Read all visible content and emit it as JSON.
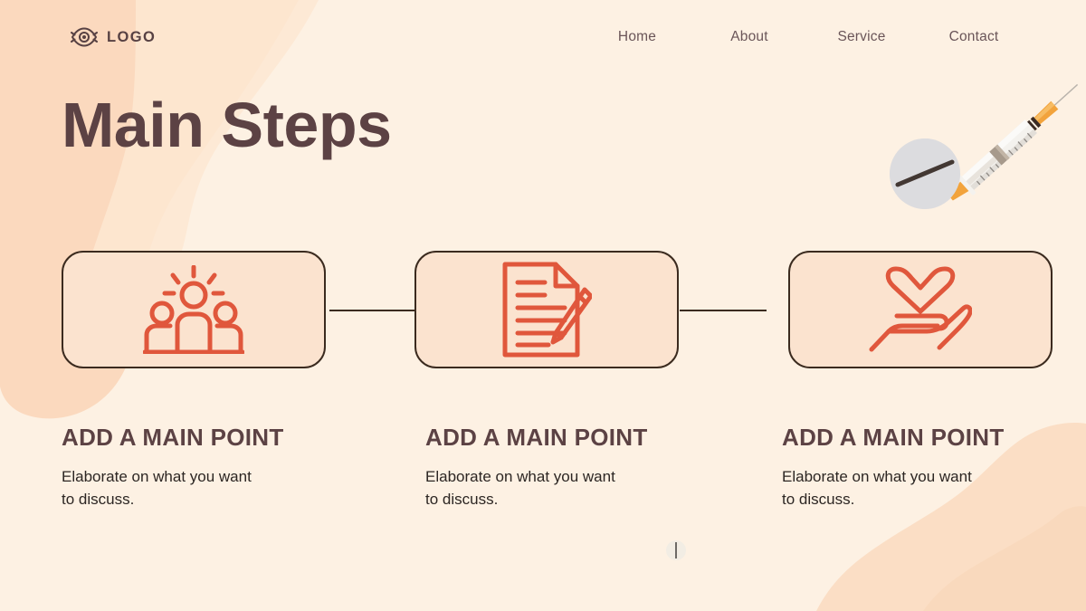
{
  "slide": {
    "title": "Main Steps",
    "background_color": "#FDF1E3",
    "accent_color": "#E0573C",
    "ink_color": "#5C4244",
    "card_fill_color": "#FBE3CF",
    "card_border_color": "#3B2B1F",
    "blob_color": "#FBD9BE"
  },
  "header": {
    "logo": {
      "icon": "eye-icon",
      "text": "LOGO"
    },
    "nav": [
      {
        "label": "Home"
      },
      {
        "label": "About"
      },
      {
        "label": "Service"
      },
      {
        "label": "Contact"
      }
    ]
  },
  "steps": [
    {
      "icon": "group-people-idea-icon",
      "title": "ADD A MAIN POINT",
      "body": "Elaborate on what you want to discuss."
    },
    {
      "icon": "document-pencil-icon",
      "title": "ADD A MAIN POINT",
      "body": "Elaborate on what you want to discuss."
    },
    {
      "icon": "heart-in-hand-icon",
      "title": "ADD A MAIN POINT",
      "body": "Elaborate on what you want to discuss."
    }
  ],
  "decorations": [
    {
      "name": "syringe-illustration"
    },
    {
      "name": "pill-tablet-illustration"
    },
    {
      "name": "small-pill-tablet-illustration"
    },
    {
      "name": "blob-top-left"
    },
    {
      "name": "blob-bottom-right"
    }
  ]
}
